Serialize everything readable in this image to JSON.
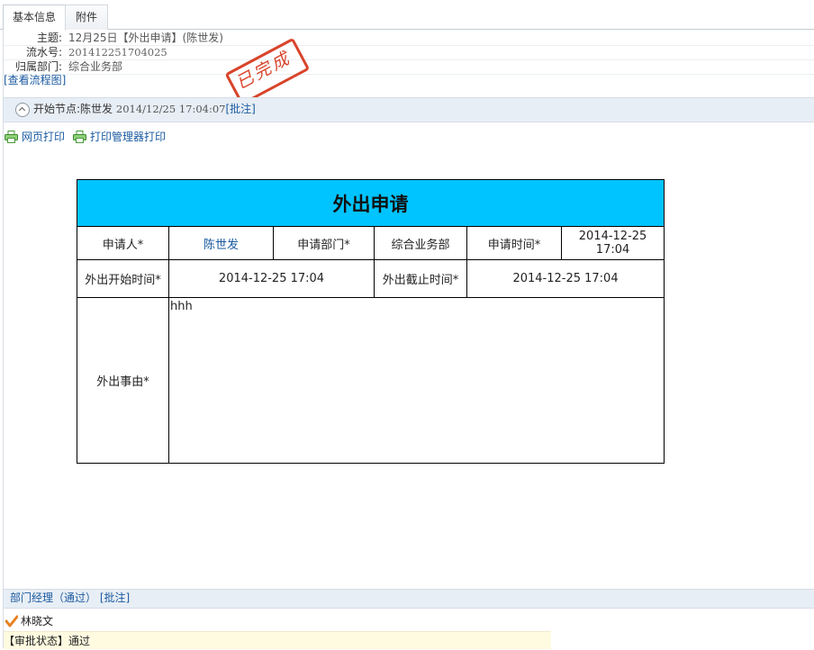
{
  "tabs": [
    {
      "label": "基本信息",
      "active": true
    },
    {
      "label": "附件",
      "active": false
    }
  ],
  "info": {
    "subject_label": "主题:",
    "subject_value": "12月25日【外出申请】(陈世发)",
    "serial_label": "流水号:",
    "serial_value": "201412251704025",
    "dept_label": "归属部门:",
    "dept_value": "综合业务部",
    "flow_link": "[查看流程图]"
  },
  "stamp": {
    "text": "已完成",
    "color": "#d9442b"
  },
  "start_node": {
    "label": "开始节点:",
    "person": "陈世发",
    "time": "2014/12/25 17:04:07",
    "annotate": "[批注]"
  },
  "print": {
    "web_print": "网页打印",
    "manager_print": "打印管理器打印"
  },
  "form": {
    "title": "外出申请",
    "title_bg": "#00c4ff",
    "applicant_label": "申请人*",
    "applicant_value": "陈世发",
    "dept_label": "申请部门*",
    "dept_value": "综合业务部",
    "time_label": "申请时间*",
    "time_value_line1": "2014-12-25",
    "time_value_line2": "17:04",
    "start_label": "外出开始时间*",
    "start_value": "2014-12-25 17:04",
    "end_label": "外出截止时间*",
    "end_value": "2014-12-25 17:04",
    "reason_label": "外出事由*",
    "reason_value": "hhh"
  },
  "dept_manager": {
    "title": "部门经理（通过）",
    "annotate": "[批注]",
    "approver": "林晓文",
    "status_text": "【审批状态】通过"
  }
}
